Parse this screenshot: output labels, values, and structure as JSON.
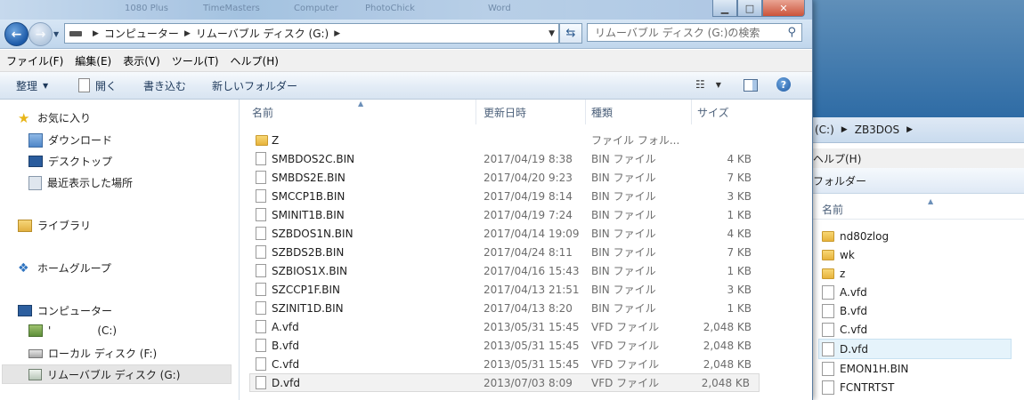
{
  "ghost_titles": [
    "1080 Plus",
    "TimeMasters",
    "Computer",
    "PhotoChick",
    "Word"
  ],
  "nav": {
    "breadcrumb": [
      "コンピューター",
      "リムーバブル ディスク (G:)"
    ],
    "search_placeholder": "リムーバブル ディスク (G:)の検索"
  },
  "menu": [
    "ファイル(F)",
    "編集(E)",
    "表示(V)",
    "ツール(T)",
    "ヘルプ(H)"
  ],
  "toolbar": {
    "organize": "整理",
    "open": "開く",
    "burn": "書き込む",
    "new_folder": "新しいフォルダー"
  },
  "sidebar": {
    "favorites": "お気に入り",
    "favorites_items": [
      "ダウンロード",
      "デスクトップ",
      "最近表示した場所"
    ],
    "libraries": "ライブラリ",
    "homegroup": "ホームグループ",
    "computer": "コンピューター",
    "drives": [
      {
        "name": "'",
        "letter": "(C:)"
      },
      {
        "name": "ローカル ディスク (F:)",
        "letter": ""
      },
      {
        "name": "リムーバブル ディスク (G:)",
        "letter": ""
      }
    ]
  },
  "columns": {
    "name": "名前",
    "date": "更新日時",
    "type": "種類",
    "size": "サイズ"
  },
  "files": [
    {
      "name": "Z",
      "date": "",
      "type": "ファイル フォル...",
      "size": "",
      "kind": "folder"
    },
    {
      "name": "SMBDOS2C.BIN",
      "date": "2017/04/19 8:38",
      "type": "BIN ファイル",
      "size": "4 KB",
      "kind": "file"
    },
    {
      "name": "SMBDS2E.BIN",
      "date": "2017/04/20 9:23",
      "type": "BIN ファイル",
      "size": "7 KB",
      "kind": "file"
    },
    {
      "name": "SMCCP1B.BIN",
      "date": "2017/04/19 8:14",
      "type": "BIN ファイル",
      "size": "3 KB",
      "kind": "file"
    },
    {
      "name": "SMINIT1B.BIN",
      "date": "2017/04/19 7:24",
      "type": "BIN ファイル",
      "size": "1 KB",
      "kind": "file"
    },
    {
      "name": "SZBDOS1N.BIN",
      "date": "2017/04/14 19:09",
      "type": "BIN ファイル",
      "size": "4 KB",
      "kind": "file"
    },
    {
      "name": "SZBDS2B.BIN",
      "date": "2017/04/24 8:11",
      "type": "BIN ファイル",
      "size": "7 KB",
      "kind": "file"
    },
    {
      "name": "SZBIOS1X.BIN",
      "date": "2017/04/16 15:43",
      "type": "BIN ファイル",
      "size": "1 KB",
      "kind": "file"
    },
    {
      "name": "SZCCP1F.BIN",
      "date": "2017/04/13 21:51",
      "type": "BIN ファイル",
      "size": "3 KB",
      "kind": "file"
    },
    {
      "name": "SZINIT1D.BIN",
      "date": "2017/04/13 8:20",
      "type": "BIN ファイル",
      "size": "1 KB",
      "kind": "file"
    },
    {
      "name": "A.vfd",
      "date": "2013/05/31 15:45",
      "type": "VFD ファイル",
      "size": "2,048 KB",
      "kind": "file"
    },
    {
      "name": "B.vfd",
      "date": "2013/05/31 15:45",
      "type": "VFD ファイル",
      "size": "2,048 KB",
      "kind": "file"
    },
    {
      "name": "C.vfd",
      "date": "2013/05/31 15:45",
      "type": "VFD ファイル",
      "size": "2,048 KB",
      "kind": "file"
    },
    {
      "name": "D.vfd",
      "date": "2013/07/03 8:09",
      "type": "VFD ファイル",
      "size": "2,048 KB",
      "kind": "file",
      "selected": true
    }
  ],
  "win2": {
    "breadcrumb": [
      "(C:)",
      "ZB3DOS"
    ],
    "menu_label": "ヘルプ(H)",
    "toolbar_label": "フォルダー",
    "column": "名前",
    "items": [
      {
        "name": "nd80zlog",
        "kind": "folder"
      },
      {
        "name": "wk",
        "kind": "folder"
      },
      {
        "name": "z",
        "kind": "folder"
      },
      {
        "name": "A.vfd",
        "kind": "file"
      },
      {
        "name": "B.vfd",
        "kind": "file"
      },
      {
        "name": "C.vfd",
        "kind": "file"
      },
      {
        "name": "D.vfd",
        "kind": "file",
        "selected": true
      },
      {
        "name": "EMON1H.BIN",
        "kind": "file"
      },
      {
        "name": "FCNTRTST",
        "kind": "file"
      }
    ]
  }
}
